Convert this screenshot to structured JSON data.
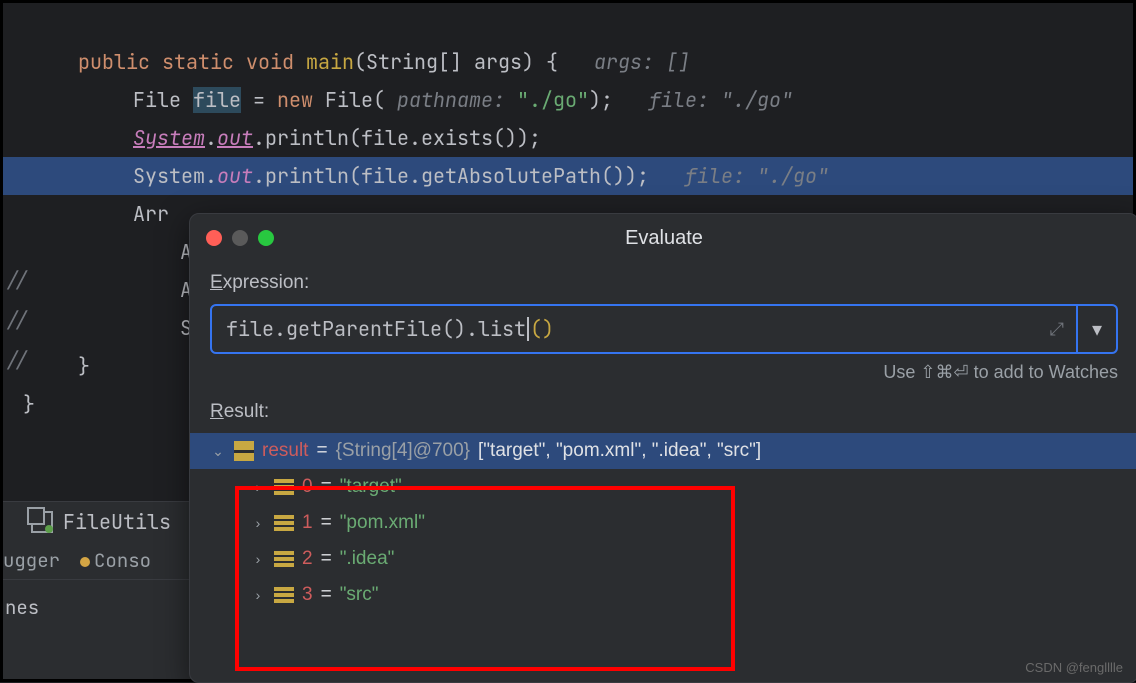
{
  "code": {
    "line1": {
      "kw_public": "public",
      "kw_static": "static",
      "kw_void": "void",
      "method": "main",
      "params": "(String[] args) {",
      "hint": "args: []"
    },
    "line2": {
      "type": "File",
      "var": "file",
      "eq": " = ",
      "kw_new": "new",
      "ctor": " File(",
      "param_hint": " pathname: ",
      "str": "\"./go\"",
      "end": ");",
      "hint": "file: \"./go\""
    },
    "line3": {
      "sys": "System",
      "dot1": ".",
      "out": "out",
      "rest": ".println(file.exists());"
    },
    "line4": {
      "sys": "System.",
      "out": "out",
      "rest": ".println(file.getAbsolutePath());",
      "hint": "file: \"./go\""
    },
    "line5": "Arr",
    "line6": "A",
    "line7": "A",
    "line8": "S",
    "line9": "}",
    "line10": "}",
    "gutter": "//"
  },
  "dialog": {
    "title": "Evaluate",
    "expression_label_u": "E",
    "expression_label": "xpression:",
    "expression_text": "file.getParentFile().list",
    "expression_paren": "()",
    "hint": "Use ⇧⌘⏎ to add to Watches",
    "result_label_u": "R",
    "result_label": "esult:",
    "result_root_name": "result",
    "result_root_eq": " = ",
    "result_root_type": "{String[4]@700} ",
    "result_root_val": "[\"target\", \"pom.xml\", \".idea\", \"src\"]",
    "items": [
      {
        "idx": "0",
        "eq": " = ",
        "val": "\"target\""
      },
      {
        "idx": "1",
        "eq": " = ",
        "val": "\"pom.xml\""
      },
      {
        "idx": "2",
        "eq": " = ",
        "val": "\".idea\""
      },
      {
        "idx": "3",
        "eq": " = ",
        "val": "\"src\""
      }
    ]
  },
  "tabs": {
    "file_tab": "FileUtils",
    "debugger": "ugger",
    "console": "Conso",
    "bottom": "nes"
  },
  "watermark": "CSDN @fenglllle"
}
